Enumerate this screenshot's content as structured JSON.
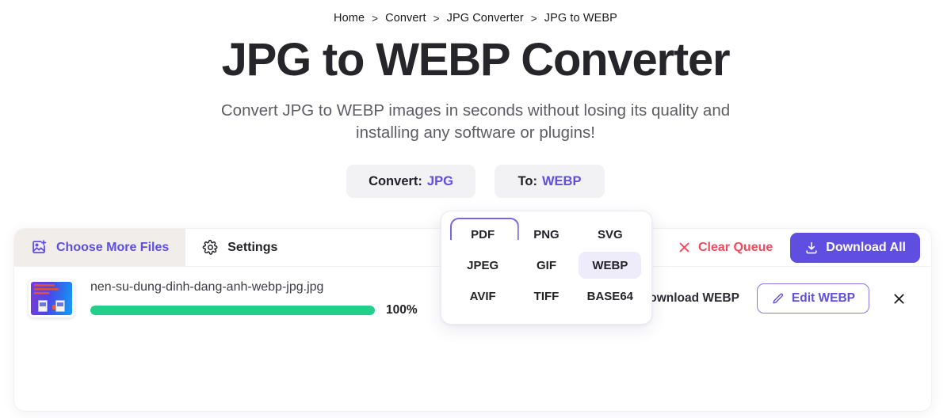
{
  "breadcrumb": {
    "separator": ">",
    "items": [
      {
        "label": "Home"
      },
      {
        "label": "Convert"
      },
      {
        "label": "JPG Converter"
      },
      {
        "label": "JPG to WEBP"
      }
    ]
  },
  "hero": {
    "title": "JPG to WEBP Converter",
    "subtitle": "Convert JPG to WEBP images in seconds without losing its quality and installing any software or plugins!"
  },
  "selector": {
    "convert_label": "Convert:",
    "convert_value": "JPG",
    "to_label": "To:",
    "to_value": "WEBP"
  },
  "format_dropdown": {
    "options": [
      {
        "label": "PDF",
        "state": "focused"
      },
      {
        "label": "PNG",
        "state": "default"
      },
      {
        "label": "SVG",
        "state": "default"
      },
      {
        "label": "JPEG",
        "state": "default"
      },
      {
        "label": "GIF",
        "state": "default"
      },
      {
        "label": "WEBP",
        "state": "selected"
      },
      {
        "label": "AVIF",
        "state": "default"
      },
      {
        "label": "TIFF",
        "state": "default"
      },
      {
        "label": "BASE64",
        "state": "default"
      }
    ]
  },
  "toolbar": {
    "choose_more_files": "Choose More Files",
    "settings": "Settings",
    "clear_queue": "Clear Queue",
    "download_all": "Download All"
  },
  "file_row": {
    "file_name": "nen-su-dung-dinh-dang-anh-webp-jpg.jpg",
    "progress_percent": 100,
    "progress_label": "100%",
    "download_label": "Download WEBP",
    "edit_label": "Edit WEBP"
  },
  "colors": {
    "accent_purple": "#5f4ee0",
    "accent_purple_light": "#eeecfa",
    "danger_red": "#f2495c",
    "success_green": "#22cf8b",
    "text_dark": "#26262a",
    "text_muted": "#5d5d66",
    "pill_bg": "#f2f1f4",
    "tab_active_bg": "#f0edea"
  }
}
